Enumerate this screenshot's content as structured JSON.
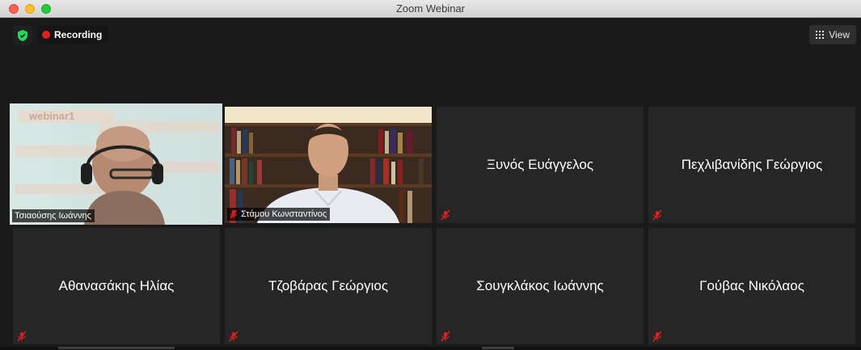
{
  "window": {
    "title": "Zoom Webinar"
  },
  "toolbar": {
    "recording_label": "Recording",
    "view_label": "View"
  },
  "participants": {
    "video": [
      {
        "name": "Τσιαούσης Ιωάννης",
        "banner_text": "webinar1"
      },
      {
        "name": "Στάμου Κωνσταντίνος"
      }
    ],
    "tiles": [
      {
        "name": "Ξυνός Ευάγγελος"
      },
      {
        "name": "Πεχλιβανίδης Γεώργιος"
      },
      {
        "name": "Αθανασάκης Ηλίας"
      },
      {
        "name": "Τζοβάρας Γεώργιος"
      },
      {
        "name": "Σουγκλάκος Ιωάννης"
      },
      {
        "name": "Γούβας Νικόλαος"
      }
    ]
  },
  "colors": {
    "active_speaker_border": "#b8d767",
    "recording_dot": "#e02020",
    "muted_icon": "#e02020"
  }
}
